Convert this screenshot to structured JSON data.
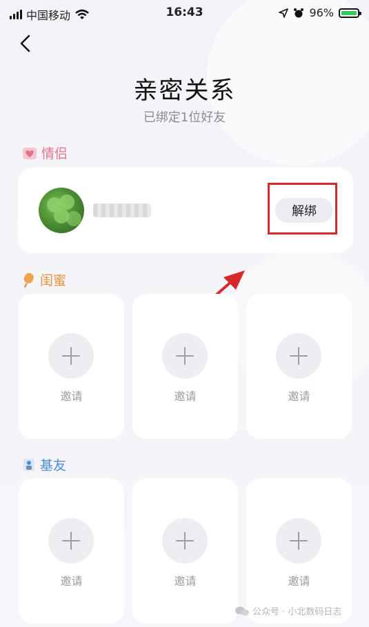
{
  "status_bar": {
    "carrier": "中国移动",
    "time": "16:43",
    "battery": "96%"
  },
  "header": {
    "title": "亲密关系",
    "subtitle": "已绑定1位好友"
  },
  "couple": {
    "label": "情侣",
    "unbind_label": "解绑"
  },
  "bestie": {
    "label": "闺蜜",
    "slots": [
      "邀请",
      "邀请",
      "邀请"
    ]
  },
  "bro": {
    "label": "基友",
    "slots": [
      "邀请",
      "邀请",
      "邀请"
    ]
  },
  "watermark": {
    "text": "公众号 · 小北数码日志"
  },
  "colors": {
    "couple": "#e2738d",
    "bestie": "#e6923c",
    "bro": "#4a8fd6",
    "highlight": "#d7282a"
  }
}
